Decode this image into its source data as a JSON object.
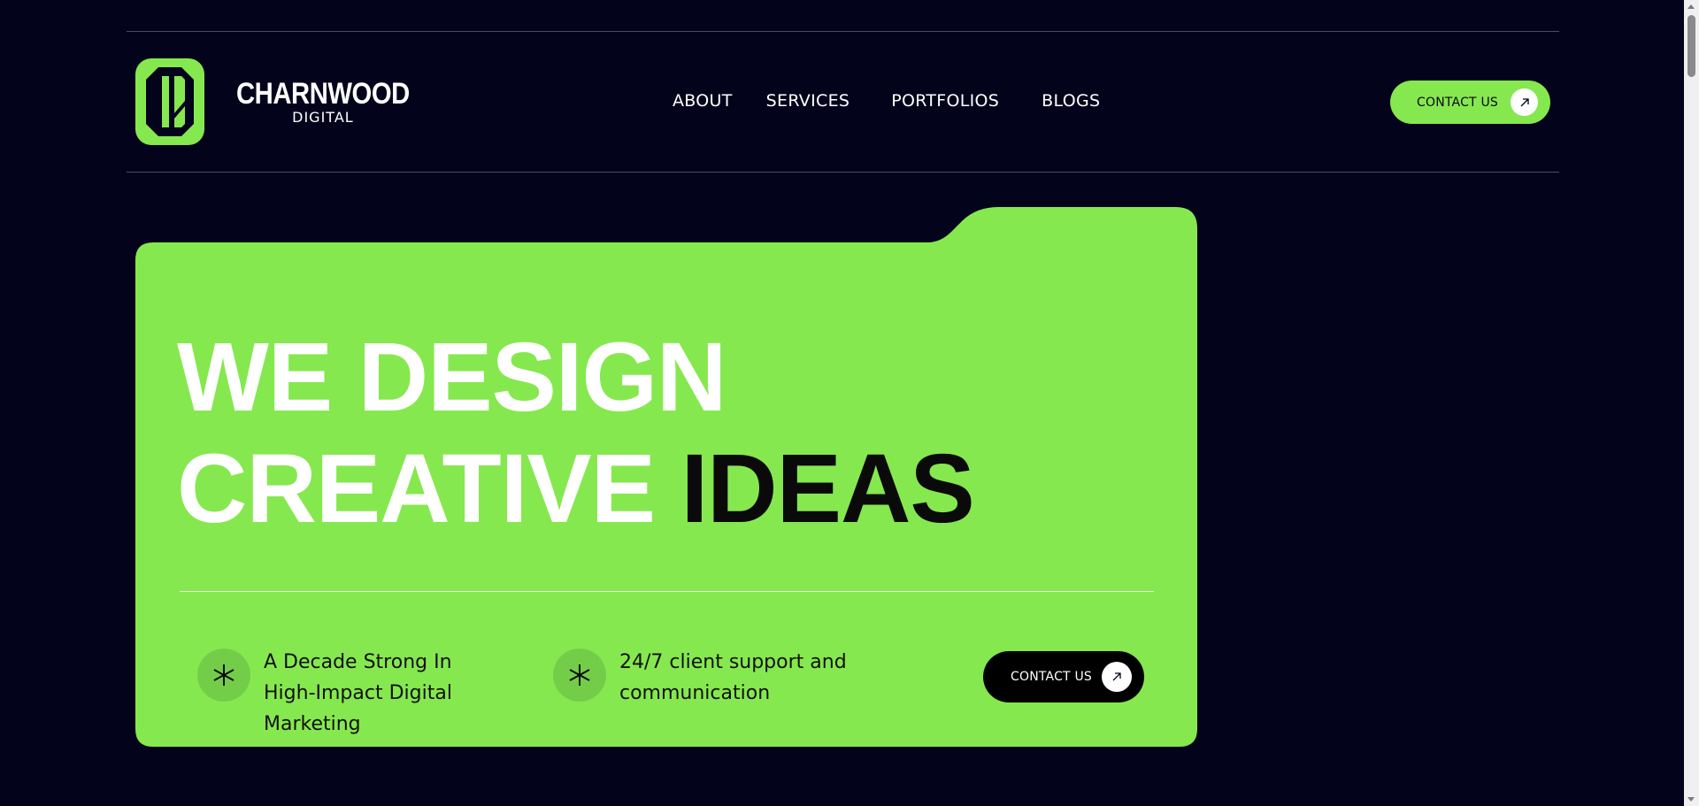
{
  "header": {
    "logo": {
      "name": "CHARNWOOD",
      "sub": "DIGITAL",
      "icon": "charnwood-logo-icon"
    },
    "nav": [
      {
        "label": "ABOUT"
      },
      {
        "label": "SERVICES"
      },
      {
        "label": "PORTFOLIOS"
      },
      {
        "label": "BLOGS"
      }
    ],
    "contact_button": {
      "label": "CONTACT US",
      "icon": "arrow-up-right-icon"
    }
  },
  "hero": {
    "headline_line1": "WE DESIGN",
    "headline_line2_white": "CREATIVE",
    "headline_line2_dark": "IDEAS",
    "features": [
      {
        "icon": "asterisk-icon",
        "text": "A Decade Strong In High-Impact Digital Marketing"
      },
      {
        "icon": "asterisk-icon",
        "text": "24/7 client support and communication"
      }
    ],
    "contact_button": {
      "label": "CONTACT US",
      "icon": "arrow-up-right-icon"
    }
  },
  "colors": {
    "background": "#03031c",
    "accent_green": "#86e84f",
    "white": "#ffffff",
    "black": "#000000"
  }
}
